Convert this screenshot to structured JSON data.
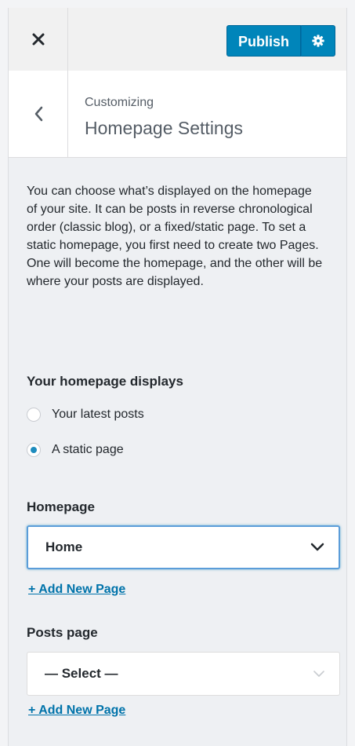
{
  "header": {
    "publish_label": "Publish",
    "close_icon": "close-icon",
    "settings_icon": "gear-icon",
    "accent_color": "#0085ba"
  },
  "section": {
    "context_label": "Customizing",
    "title": "Homepage Settings",
    "back_icon": "chevron-left-icon"
  },
  "description": "You can choose what’s displayed on the homepage of your site. It can be posts in reverse chronological order (classic blog), or a fixed/static page. To set a static homepage, you first need to create two Pages. One will become the homepage, and the other will be where your posts are displayed.",
  "homepage_displays": {
    "label": "Your homepage displays",
    "options": [
      {
        "label": "Your latest posts",
        "selected": false
      },
      {
        "label": "A static page",
        "selected": true
      }
    ]
  },
  "homepage": {
    "label": "Homepage",
    "selected_value": "Home",
    "add_link": "+ Add New Page"
  },
  "posts_page": {
    "label": "Posts page",
    "selected_value": "— Select —",
    "add_link": "+ Add New Page"
  }
}
